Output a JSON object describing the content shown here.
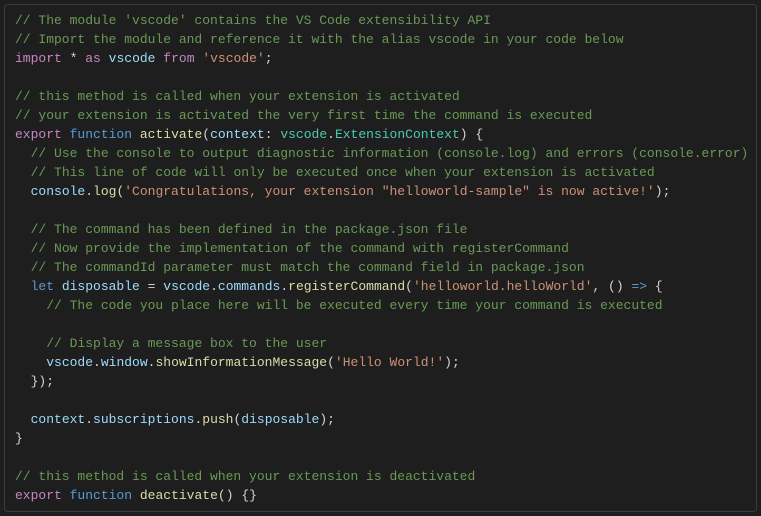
{
  "code": {
    "c1": "// The module 'vscode' contains the VS Code extensibility API",
    "c2": "// Import the module and reference it with the alias vscode in your code below",
    "kw_import": "import",
    "star": "*",
    "kw_as": "as",
    "v_vscode": "vscode",
    "kw_from": "from",
    "s_vscode_mod": "'vscode'",
    "semi": ";",
    "c3": "// this method is called when your extension is activated",
    "c4": "// your extension is activated the very first time the command is executed",
    "kw_export": "export",
    "kw_function": "function",
    "fn_activate": "activate",
    "p_context": "context",
    "colon": ":",
    "t_vscode": "vscode",
    "dot": ".",
    "t_extctx": "ExtensionContext",
    "brace_o": "{",
    "brace_c": "}",
    "paren_o": "(",
    "paren_c": ")",
    "c5": "// Use the console to output diagnostic information (console.log) and errors (console.error)",
    "c6": "// This line of code will only be executed once when your extension is activated",
    "v_console": "console",
    "fn_log": "log",
    "s_congrats": "'Congratulations, your extension \"helloworld-sample\" is now active!'",
    "c7": "// The command has been defined in the package.json file",
    "c8": "// Now provide the implementation of the command with registerCommand",
    "c9": "// The commandId parameter must match the command field in package.json",
    "kw_let": "let",
    "v_disposable": "disposable",
    "eq": "=",
    "p_commands": "commands",
    "fn_register": "registerCommand",
    "s_cmdid": "'helloworld.helloWorld'",
    "comma": ",",
    "arrow": "=>",
    "c10": "// The code you place here will be executed every time your command is executed",
    "c11": "// Display a message box to the user",
    "p_window": "window",
    "fn_showmsg": "showInformationMessage",
    "s_hello": "'Hello World!'",
    "p_subscriptions": "subscriptions",
    "fn_push": "push",
    "c12": "// this method is called when your extension is deactivated",
    "fn_deactivate": "deactivate"
  }
}
